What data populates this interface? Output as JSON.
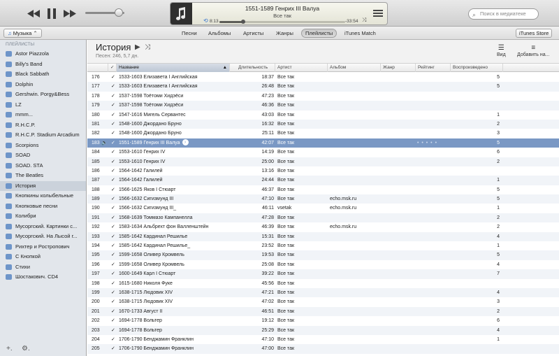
{
  "toolbar": {
    "prev_icon": "rewind-icon",
    "pause_icon": "pause-icon",
    "next_icon": "fast-forward-icon",
    "volume_level": 0.85,
    "now_playing": {
      "title": "1551-1589 Генрих III Валуа",
      "artist": "Все так",
      "elapsed": "8:13",
      "remaining": "-33:54",
      "progress": 0.19
    },
    "search_placeholder": "Поиск в медиатеке"
  },
  "navbar": {
    "library_label": "Музыка ⌃",
    "tabs": [
      {
        "label": "Песни",
        "active": false
      },
      {
        "label": "Альбомы",
        "active": false
      },
      {
        "label": "Артисты",
        "active": false
      },
      {
        "label": "Жанры",
        "active": false
      },
      {
        "label": "Плейлисты",
        "active": true
      },
      {
        "label": "iTunes Match",
        "active": false
      }
    ],
    "store_label": "iTunes Store"
  },
  "sidebar": {
    "header": "ПЛЕЙЛИСТЫ",
    "items": [
      {
        "label": "Astor Piazzola"
      },
      {
        "label": "Billy's Band"
      },
      {
        "label": "Black Sabbath"
      },
      {
        "label": "Dolphin"
      },
      {
        "label": "Gershwin. Porgy&Bess"
      },
      {
        "label": "LZ"
      },
      {
        "label": "mmm..."
      },
      {
        "label": "R.H.C.P."
      },
      {
        "label": "R.H.C.P. Stadium Arcadium"
      },
      {
        "label": "Scorpions"
      },
      {
        "label": "SOAD"
      },
      {
        "label": "SOAD. STA"
      },
      {
        "label": "The Beatles"
      },
      {
        "label": "История",
        "selected": true
      },
      {
        "label": "Кнопкины колыбельные"
      },
      {
        "label": "Кнопковые песни"
      },
      {
        "label": "Колибри"
      },
      {
        "label": "Мусоргский. Картинки с..."
      },
      {
        "label": "Мусоргский. На Лысой г..."
      },
      {
        "label": "Рихтер и Ростропович"
      },
      {
        "label": "С Кнопкой"
      },
      {
        "label": "Стихи"
      },
      {
        "label": "Шостакович. CD4"
      }
    ],
    "add_label": "+.",
    "settings_label": "⚙."
  },
  "header": {
    "title": "История",
    "subtitle": "Песен: 246, 5,7 дн.",
    "view_label": "Вид",
    "add_to_label": "Добавить на..."
  },
  "columns": {
    "check": "✓",
    "name": "Название",
    "duration": "Длительность",
    "artist": "Артист",
    "album": "Альбом",
    "genre": "Жанр",
    "rating": "Рейтинг",
    "plays": "Воспроизведено"
  },
  "rows": [
    {
      "num": "176",
      "name": "1533-1603 Елизавета I Английская",
      "dur": "18:37",
      "artist": "Все так",
      "album": "",
      "plays": "5"
    },
    {
      "num": "177",
      "name": "1533-1603 Елизавета I Английская",
      "dur": "26:48",
      "artist": "Все так",
      "album": "",
      "plays": "5"
    },
    {
      "num": "178",
      "name": "1537-1598 Тоётоми Хидэёси",
      "dur": "47:23",
      "artist": "Все так",
      "album": "",
      "plays": ""
    },
    {
      "num": "179",
      "name": "1537-1598 Тоётоми Хидэёси",
      "dur": "46:36",
      "artist": "Все так",
      "album": "",
      "plays": ""
    },
    {
      "num": "180",
      "name": "1547-1616 Мигель Сервантес",
      "dur": "43:03",
      "artist": "Все так",
      "album": "",
      "plays": "1"
    },
    {
      "num": "181",
      "name": "1548-1600 Джордано Бруно",
      "dur": "16:32",
      "artist": "Все так",
      "album": "",
      "plays": "2"
    },
    {
      "num": "182",
      "name": "1548-1600 Джордано Бруно",
      "dur": "25:11",
      "artist": "Все так",
      "album": "",
      "plays": "3"
    },
    {
      "num": "183",
      "name": "1551-1589 Генрих III Валуа",
      "dur": "42:07",
      "artist": "Все так",
      "album": "",
      "plays": "5",
      "playing": true
    },
    {
      "num": "184",
      "name": "1553-1610 Генрих IV",
      "dur": "14:19",
      "artist": "Все так",
      "album": "",
      "plays": "6"
    },
    {
      "num": "185",
      "name": "1553-1610 Генрих IV",
      "dur": "25:00",
      "artist": "Все так",
      "album": "",
      "plays": "2"
    },
    {
      "num": "186",
      "name": "1564-1642 Галилей",
      "dur": "13:16",
      "artist": "Все так",
      "album": "",
      "plays": ""
    },
    {
      "num": "187",
      "name": "1564-1642 Галилей",
      "dur": "24:44",
      "artist": "Все так",
      "album": "",
      "plays": "1"
    },
    {
      "num": "188",
      "name": "1566-1625 Яков I Стюарт",
      "dur": "46:37",
      "artist": "Все так",
      "album": "",
      "plays": "5"
    },
    {
      "num": "189",
      "name": "1566-1632 Сигизмунд III",
      "dur": "47:10",
      "artist": "Все так",
      "album": "echo.msk.ru",
      "plays": "5"
    },
    {
      "num": "190",
      "name": "1566-1632 Сигизмунд III_",
      "dur": "46:11",
      "artist": "vsetak",
      "album": "echo.msk.ru",
      "plays": "1"
    },
    {
      "num": "191",
      "name": "1568-1639 Томмазо Кампанелла",
      "dur": "47:28",
      "artist": "Все так",
      "album": "",
      "plays": "2"
    },
    {
      "num": "192",
      "name": "1583-1634 Альбрехт фон Валленштейн",
      "dur": "46:39",
      "artist": "Все так",
      "album": "echo.msk.ru",
      "plays": "2"
    },
    {
      "num": "193",
      "name": "1585-1642 Кардинал Решилье",
      "dur": "15:31",
      "artist": "Все так",
      "album": "",
      "plays": "4"
    },
    {
      "num": "194",
      "name": "1585-1642 Кардинал Решилье_",
      "dur": "23:52",
      "artist": "Все так",
      "album": "",
      "plays": "1"
    },
    {
      "num": "195",
      "name": "1599-1658 Оливер Кромвель",
      "dur": "19:53",
      "artist": "Все так",
      "album": "",
      "plays": "5"
    },
    {
      "num": "196",
      "name": "1599-1658 Оливер Кромвель",
      "dur": "25:08",
      "artist": "Все так",
      "album": "",
      "plays": "4"
    },
    {
      "num": "197",
      "name": "1600-1649 Карл I Стюарт",
      "dur": "39:22",
      "artist": "Все так",
      "album": "",
      "plays": "7"
    },
    {
      "num": "198",
      "name": "1615-1680 Николя Фуке",
      "dur": "45:56",
      "artist": "Все так",
      "album": "",
      "plays": ""
    },
    {
      "num": "199",
      "name": "1638-1715 Людовик XIV",
      "dur": "47:21",
      "artist": "Все так",
      "album": "",
      "plays": "4"
    },
    {
      "num": "200",
      "name": "1638-1715 Людовик XIV",
      "dur": "47:02",
      "artist": "Все так",
      "album": "",
      "plays": "3"
    },
    {
      "num": "201",
      "name": "1670-1733 Август II",
      "dur": "46:51",
      "artist": "Все так",
      "album": "",
      "plays": "2"
    },
    {
      "num": "202",
      "name": "1694-1778 Вольтер",
      "dur": "19:12",
      "artist": "Все так",
      "album": "",
      "plays": "6"
    },
    {
      "num": "203",
      "name": "1694-1778 Вольтер",
      "dur": "25:29",
      "artist": "Все так",
      "album": "",
      "plays": "4"
    },
    {
      "num": "204",
      "name": "1706-1790 Бенджамин Франклин",
      "dur": "47:10",
      "artist": "Все так",
      "album": "",
      "plays": "1"
    },
    {
      "num": "205",
      "name": "1706-1790 Бенджамин Франклин",
      "dur": "47:00",
      "artist": "Все так",
      "album": "",
      "plays": ""
    }
  ],
  "colors": {
    "selection": "#7a98c4",
    "sidebar_bg": "#e2e6eb",
    "row_alt": "#f1f4f8"
  }
}
